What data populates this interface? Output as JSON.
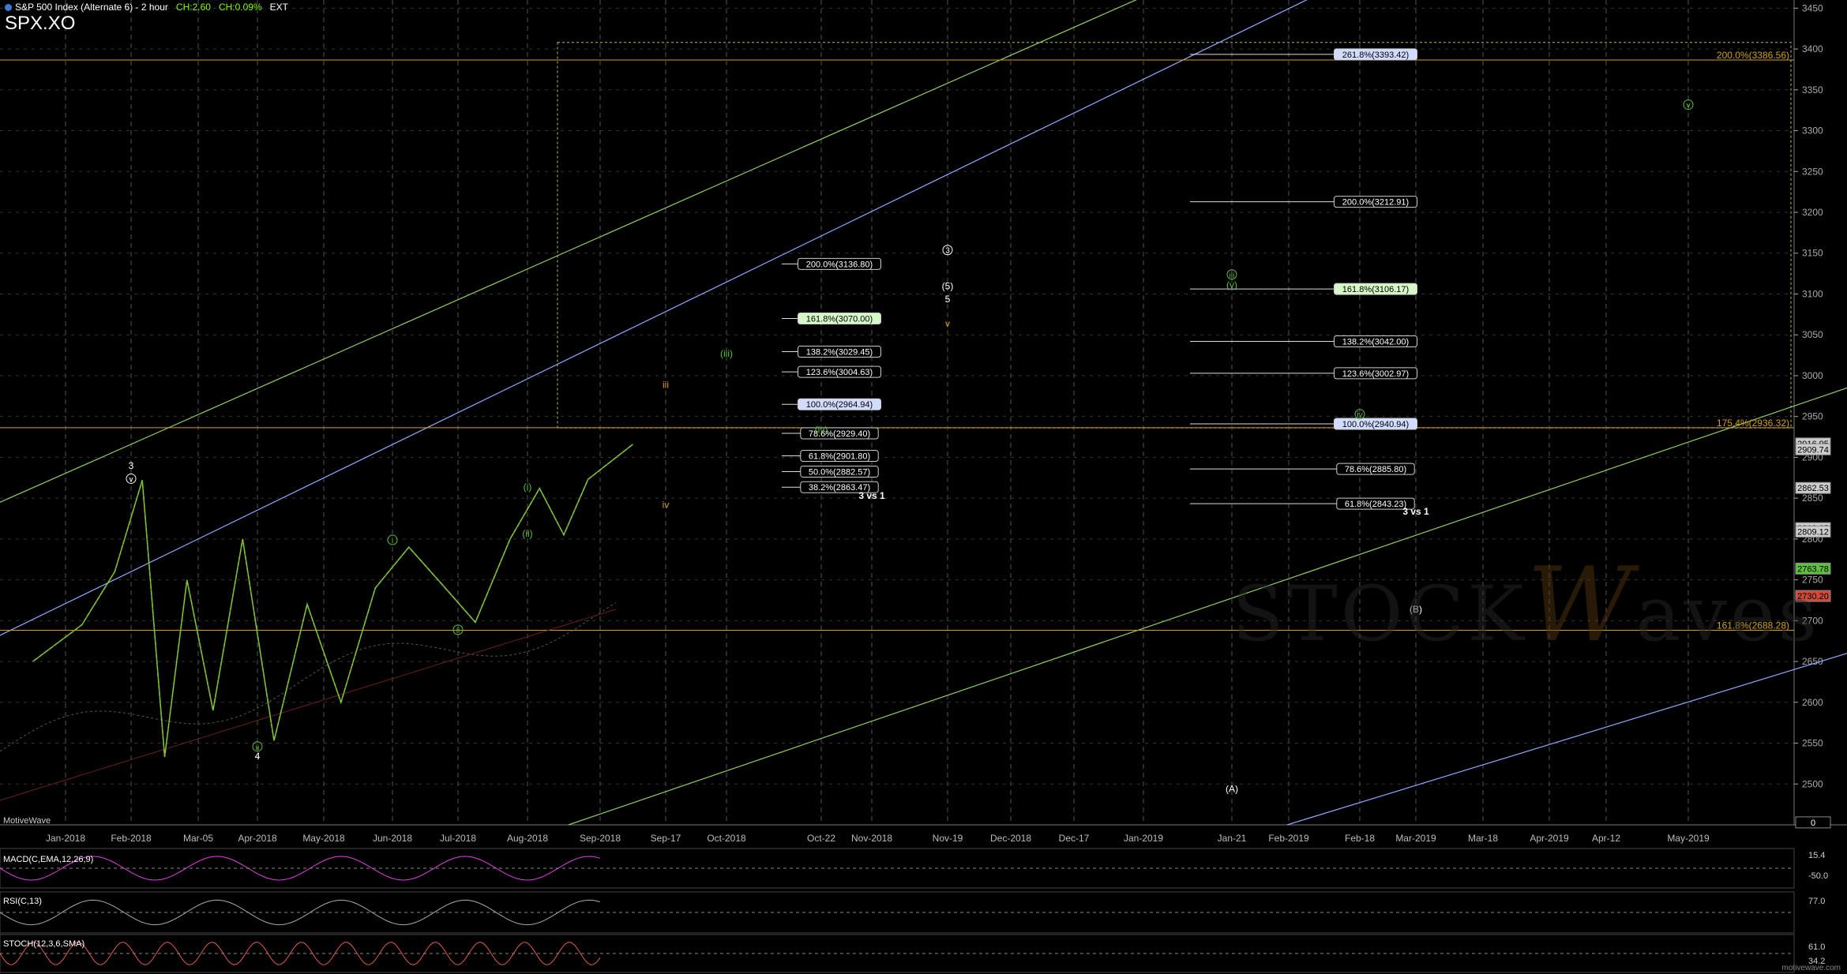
{
  "header": {
    "title": "S&P 500 Index (Alternate 6) - 2 hour",
    "change": "CH:2.60",
    "change_pct": "CH:0.09%",
    "ext": "EXT",
    "symbol": "SPX.XO"
  },
  "watermark": {
    "prefix": "STOCK",
    "w": "W",
    "suffix": "aves"
  },
  "credit": "MotiveWave",
  "footer_url": "motivewave.com",
  "indicators": {
    "macd": "MACD(C,EMA,12,26,9)",
    "rsi": "RSI(C,13)",
    "stoch": "STOCH(12,3,6,SMA)",
    "macd_values": [
      "15.4",
      "-50.0"
    ],
    "rsi_values": [
      "77.0"
    ],
    "stoch_values": [
      "61.0",
      "34.2"
    ]
  },
  "chart_data": {
    "type": "line",
    "title": "S&P 500 Index (Alternate 6) - 2 hour",
    "ylim": [
      2450,
      3460
    ],
    "yticks": [
      2500,
      2550,
      2600,
      2650,
      2700,
      2750,
      2800,
      2850,
      2900,
      2950,
      3000,
      3050,
      3100,
      3150,
      3200,
      3250,
      3300,
      3350,
      3400,
      3450
    ],
    "xlabels": [
      "Jan-2018",
      "Feb-2018",
      "Mar-05",
      "Apr-2018",
      "May-2018",
      "Jun-2018",
      "Jul-2018",
      "Aug-2018",
      "Sep-2018",
      "Sep-17",
      "Oct-2018",
      "Oct-22",
      "Nov-2018",
      "Nov-19",
      "Dec-2018",
      "Dec-17",
      "Jan-2019",
      "Jan-21",
      "Feb-2019",
      "Feb-18",
      "Mar-2019",
      "Mar-18",
      "Apr-2019",
      "Apr-12",
      "May-2019"
    ],
    "price_path": [
      [
        "Dec-2017",
        2650
      ],
      [
        "Jan-2018",
        2695
      ],
      [
        "Jan-2018",
        2760
      ],
      [
        "Feb-2018",
        2872
      ],
      [
        "Feb-2018",
        2533
      ],
      [
        "Feb-2018",
        2750
      ],
      [
        "Mar-05",
        2590
      ],
      [
        "Mar-05",
        2800
      ],
      [
        "Apr-2018",
        2553
      ],
      [
        "Apr-2018",
        2720
      ],
      [
        "May-2018",
        2600
      ],
      [
        "May-2018",
        2740
      ],
      [
        "Jun-2018",
        2790
      ],
      [
        "Jun-2018",
        2745
      ],
      [
        "Jul-2018",
        2698
      ],
      [
        "Jul-2018",
        2800
      ],
      [
        "Aug-2018",
        2862
      ],
      [
        "Aug-2018",
        2805
      ],
      [
        "Aug-2018",
        2873
      ],
      [
        "Sep-2018",
        2916
      ]
    ],
    "price_labels": [
      {
        "value": "2916.95",
        "price": 2916.95,
        "color": "#cccccc"
      },
      {
        "value": "2909.74",
        "price": 2909.74,
        "color": "#cccccc"
      },
      {
        "value": "2862.53",
        "price": 2862.53,
        "color": "#cccccc"
      },
      {
        "value": "2813.25",
        "price": 2813.25,
        "color": "#cccccc"
      },
      {
        "value": "2809.12",
        "price": 2809.12,
        "color": "#cccccc"
      },
      {
        "value": "2763.78",
        "price": 2763.78,
        "color": "#5fbf3f"
      },
      {
        "value": "2730.20",
        "price": 2730.2,
        "color": "#d04a3a"
      },
      {
        "value": "0",
        "price": 2453,
        "color": "#000000"
      }
    ],
    "horizontal_levels": [
      {
        "label": "200.0%(3386.56)",
        "price": 3386.56,
        "color": "#d4a017"
      },
      {
        "label": "175.4%(2936.32)",
        "price": 2936.32,
        "color": "#d4a017"
      },
      {
        "label": "161.8%(2688.28)",
        "price": 2688.28,
        "color": "#d4a017"
      }
    ],
    "fib_left": [
      {
        "label": "200.0%(3136.80)",
        "price": 3136.8
      },
      {
        "label": "161.8%(3070.00)",
        "price": 3070.0,
        "highlight": "green"
      },
      {
        "label": "138.2%(3029.45)",
        "price": 3029.45
      },
      {
        "label": "123.6%(3004.63)",
        "price": 3004.63
      },
      {
        "label": "100.0%(2964.94)",
        "price": 2964.94,
        "highlight": "blue"
      },
      {
        "label": "78.6%(2929.40)",
        "price": 2929.4
      },
      {
        "label": "61.8%(2901.80)",
        "price": 2901.8
      },
      {
        "label": "50.0%(2882.57)",
        "price": 2882.57
      },
      {
        "label": "38.2%(2863.47)",
        "price": 2863.47
      }
    ],
    "fib_right": [
      {
        "label": "261.8%(3393.42)",
        "price": 3393.42,
        "highlight": "blue"
      },
      {
        "label": "200.0%(3212.91)",
        "price": 3212.91
      },
      {
        "label": "161.8%(3106.17)",
        "price": 3106.17,
        "highlight": "green"
      },
      {
        "label": "138.2%(3042.00)",
        "price": 3042.0
      },
      {
        "label": "123.6%(3002.97)",
        "price": 3002.97
      },
      {
        "label": "100.0%(2940.94)",
        "price": 2940.94,
        "highlight": "blue"
      },
      {
        "label": "78.6%(2885.80)",
        "price": 2885.8
      },
      {
        "label": "61.8%(2843.23)",
        "price": 2843.23
      }
    ],
    "wave_labels": [
      {
        "text": "3",
        "x": "Feb-2018",
        "price": 2886,
        "color": "#ffffff"
      },
      {
        "text": "v",
        "x": "Feb-2018",
        "price": 2870,
        "color": "#ffffff",
        "circle": true
      },
      {
        "text": "4",
        "x": "Apr-2018",
        "price": 2530,
        "color": "#ffffff"
      },
      {
        "text": "ii",
        "x": "Apr-2018",
        "price": 2542,
        "color": "#5fbf3f",
        "circle": true
      },
      {
        "text": "i",
        "x": "Jun-2018",
        "price": 2795,
        "color": "#5fbf3f",
        "circle": true
      },
      {
        "text": "ii",
        "x": "Jul-2018",
        "price": 2685,
        "color": "#5fbf3f",
        "circle": true
      },
      {
        "text": "(i)",
        "x": "Aug-2018",
        "price": 2860,
        "color": "#5fbf3f"
      },
      {
        "text": "(ii)",
        "x": "Aug-2018",
        "price": 2803,
        "color": "#5fbf3f"
      },
      {
        "text": "iii",
        "x": "Sep-17",
        "price": 2985,
        "color": "#d4a017"
      },
      {
        "text": "iv",
        "x": "Sep-17",
        "price": 2838,
        "color": "#d4a017"
      },
      {
        "text": "(iii)",
        "x": "Oct-2018",
        "price": 3023,
        "color": "#5fbf3f"
      },
      {
        "text": "(iv)",
        "x": "Oct-22",
        "price": 2930,
        "color": "#5fbf3f"
      },
      {
        "text": "3 vs 1",
        "x": "Nov-2018",
        "price": 2849,
        "color": "#ffffff",
        "bold": true
      },
      {
        "text": "v",
        "x": "Nov-19",
        "price": 3060,
        "color": "#d4a017"
      },
      {
        "text": "3",
        "x": "Nov-19",
        "price": 3150,
        "color": "#ffffff",
        "circle": true
      },
      {
        "text": "(5)",
        "x": "Nov-19",
        "price": 3106,
        "color": "#ffffff"
      },
      {
        "text": "5",
        "x": "Nov-19",
        "price": 3090,
        "color": "#ffffff"
      },
      {
        "text": "iii",
        "x": "Jan-21",
        "price": 3120,
        "color": "#5fbf3f",
        "circle": true
      },
      {
        "text": "(v)",
        "x": "Jan-21",
        "price": 3107,
        "color": "#5fbf3f"
      },
      {
        "text": "iv",
        "x": "Feb-18",
        "price": 2949,
        "color": "#5fbf3f",
        "circle": true
      },
      {
        "text": "3 vs 1",
        "x": "Mar-2019",
        "price": 2830,
        "color": "#ffffff",
        "bold": true
      },
      {
        "text": "(B)",
        "x": "Mar-2019",
        "price": 2710,
        "color": "#ffffff"
      },
      {
        "text": "(A)",
        "x": "Jan-21",
        "price": 2490,
        "color": "#ffffff"
      },
      {
        "text": "v",
        "x": "May-2019",
        "price": 3328,
        "color": "#5fbf3f",
        "circle": true
      }
    ],
    "channels": [
      {
        "color": "#8fcf5f",
        "from": [
          0,
          2845
        ],
        "to": [
          1450,
          3465
        ]
      },
      {
        "color": "#8fa8ff",
        "from": [
          0,
          2682
        ],
        "to": [
          1665,
          3465
        ]
      },
      {
        "color": "#8fcf5f",
        "from": [
          720,
          2450
        ],
        "to": [
          2339,
          2985
        ]
      },
      {
        "color": "#8fa8ff",
        "from": [
          1630,
          2450
        ],
        "to": [
          2339,
          2660
        ]
      }
    ],
    "grid": true,
    "legend": "none"
  }
}
